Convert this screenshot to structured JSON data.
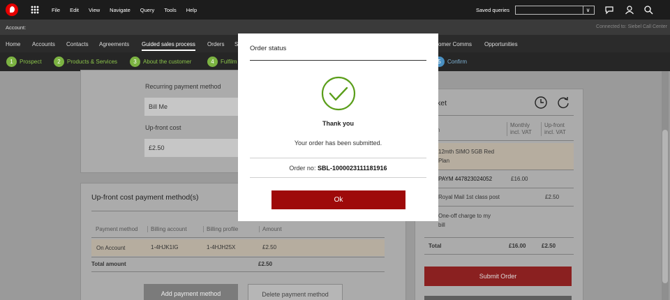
{
  "menubar": {
    "menus": [
      "File",
      "Edit",
      "View",
      "Navigate",
      "Query",
      "Tools",
      "Help"
    ],
    "saved_queries_label": "Saved queries",
    "saved_queries_value": "",
    "chevron": "∨"
  },
  "account_bar": {
    "account_label": "Account:",
    "connection": "Connected to: Siebel Call Center"
  },
  "nav": {
    "tabs": [
      "Home",
      "Accounts",
      "Contacts",
      "Agreements",
      "Guided sales process",
      "Orders",
      "S",
      "omer Comms",
      "Opportunities"
    ],
    "active_tab": "Guided sales process"
  },
  "steps": [
    {
      "num": "1",
      "label": "Prospect"
    },
    {
      "num": "2",
      "label": "Products & Services"
    },
    {
      "num": "3",
      "label": "About the customer"
    },
    {
      "num": "4",
      "label": "Fulfilm"
    },
    {
      "num": "5",
      "label": "Confirm"
    }
  ],
  "payment_details": {
    "recurring_label": "Recurring payment method",
    "recurring_value": "Bill Me",
    "upfront_label": "Up-front cost",
    "upfront_value": "£2.50"
  },
  "payment_methods": {
    "title": "Up-front cost payment method(s)",
    "columns": [
      "Payment method",
      "Billing account",
      "Billing profile",
      "Amount"
    ],
    "row": [
      "On Account",
      "1-4HJK1IG",
      "1-4HJH25X",
      "£2.50"
    ],
    "total_label": "Total amount",
    "total_value": "£2.50",
    "add_button": "Add payment method",
    "delete_button": "Delete payment method"
  },
  "basket": {
    "title": "ket",
    "col_item": "n",
    "col_monthly": [
      "Monthly",
      "incl. VAT"
    ],
    "col_upfront": [
      "Up-front",
      "incl. VAT"
    ],
    "items": [
      {
        "name": [
          "12mth SIMO 5GB Red",
          "Plan"
        ],
        "monthly": "",
        "upfront": ""
      },
      {
        "name": [
          "PAYM 447823024052"
        ],
        "monthly": "£16.00",
        "upfront": ""
      },
      {
        "name": [
          "Royal Mail 1st class post"
        ],
        "monthly": "",
        "upfront": "£2.50"
      },
      {
        "name": [
          "One-off charge to my",
          "bill"
        ],
        "monthly": "",
        "upfront": ""
      }
    ],
    "total_label": "Total",
    "total_monthly": "£16.00",
    "total_upfront": "£2.50",
    "submit_button": "Submit Order"
  },
  "modal": {
    "title": "Order status",
    "thanks": "Thank you",
    "message": "Your order has been submitted.",
    "order_label": "Order no:",
    "order_number": "SBL-1000023111181916",
    "ok_button": "Ok"
  },
  "colors": {
    "brand_red": "#e60000",
    "ok_red": "#9e0a0a",
    "check_green": "#5a9e1a",
    "step_green": "#7cb342"
  }
}
